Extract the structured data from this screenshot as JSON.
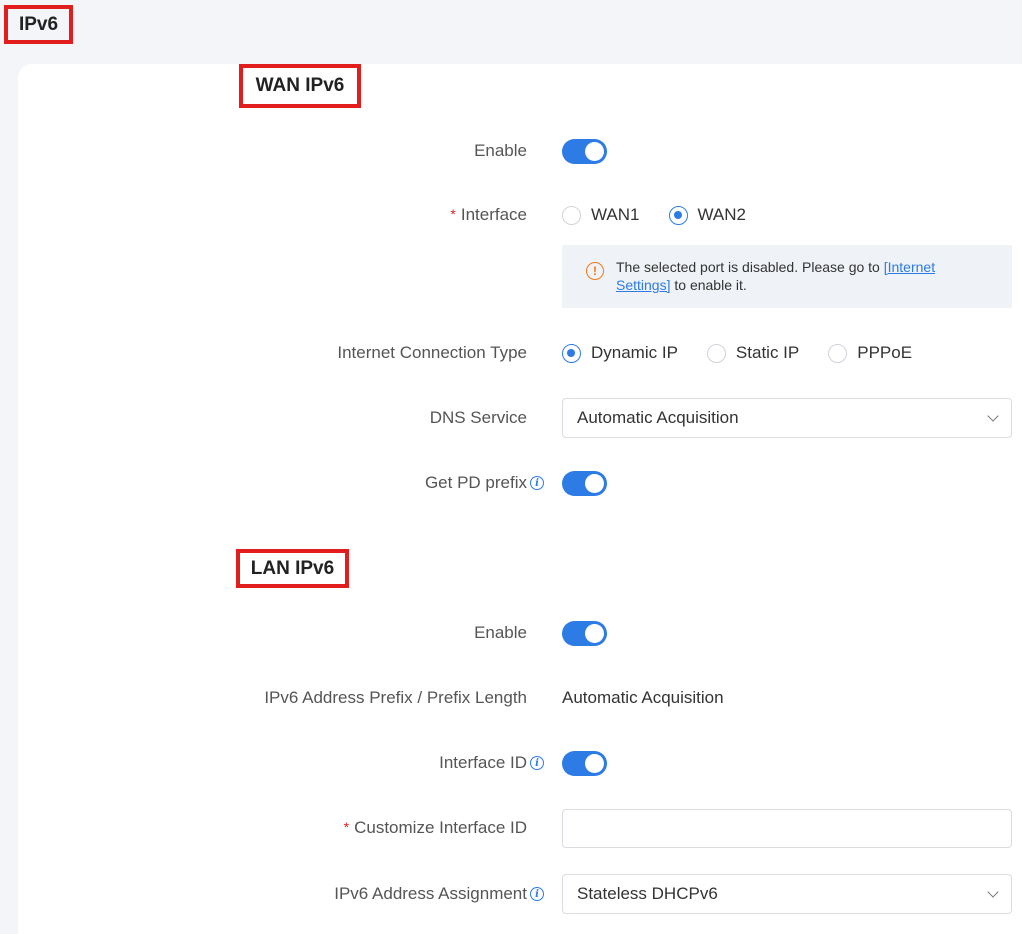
{
  "page": {
    "title": "IPv6"
  },
  "wan": {
    "title": "WAN IPv6",
    "enable_label": "Enable",
    "interface": {
      "label": "Interface",
      "required_mark": "*",
      "options": [
        "WAN1",
        "WAN2"
      ],
      "selected": "WAN2"
    },
    "notice": {
      "text_before": "The selected port is disabled. Please go to ",
      "link": "[Internet Settings]",
      "text_after": " to enable it."
    },
    "connection_type": {
      "label": "Internet Connection Type",
      "options": [
        "Dynamic IP",
        "Static IP",
        "PPPoE"
      ],
      "selected": "Dynamic IP"
    },
    "dns": {
      "label": "DNS Service",
      "value": "Automatic Acquisition"
    },
    "pd_prefix": {
      "label": "Get PD prefix"
    }
  },
  "lan": {
    "title": "LAN IPv6",
    "enable_label": "Enable",
    "prefix": {
      "label": "IPv6 Address Prefix / Prefix Length",
      "value": "Automatic Acquisition"
    },
    "interface_id": {
      "label": "Interface ID"
    },
    "custom_interface_id": {
      "label": "Customize Interface ID",
      "required_mark": "*",
      "value": ""
    },
    "assignment": {
      "label": "IPv6 Address Assignment",
      "value": "Stateless DHCPv6"
    }
  },
  "colors": {
    "accent": "#2d7be5",
    "highlight_border": "#e11d1d",
    "warning": "#f07a16"
  }
}
